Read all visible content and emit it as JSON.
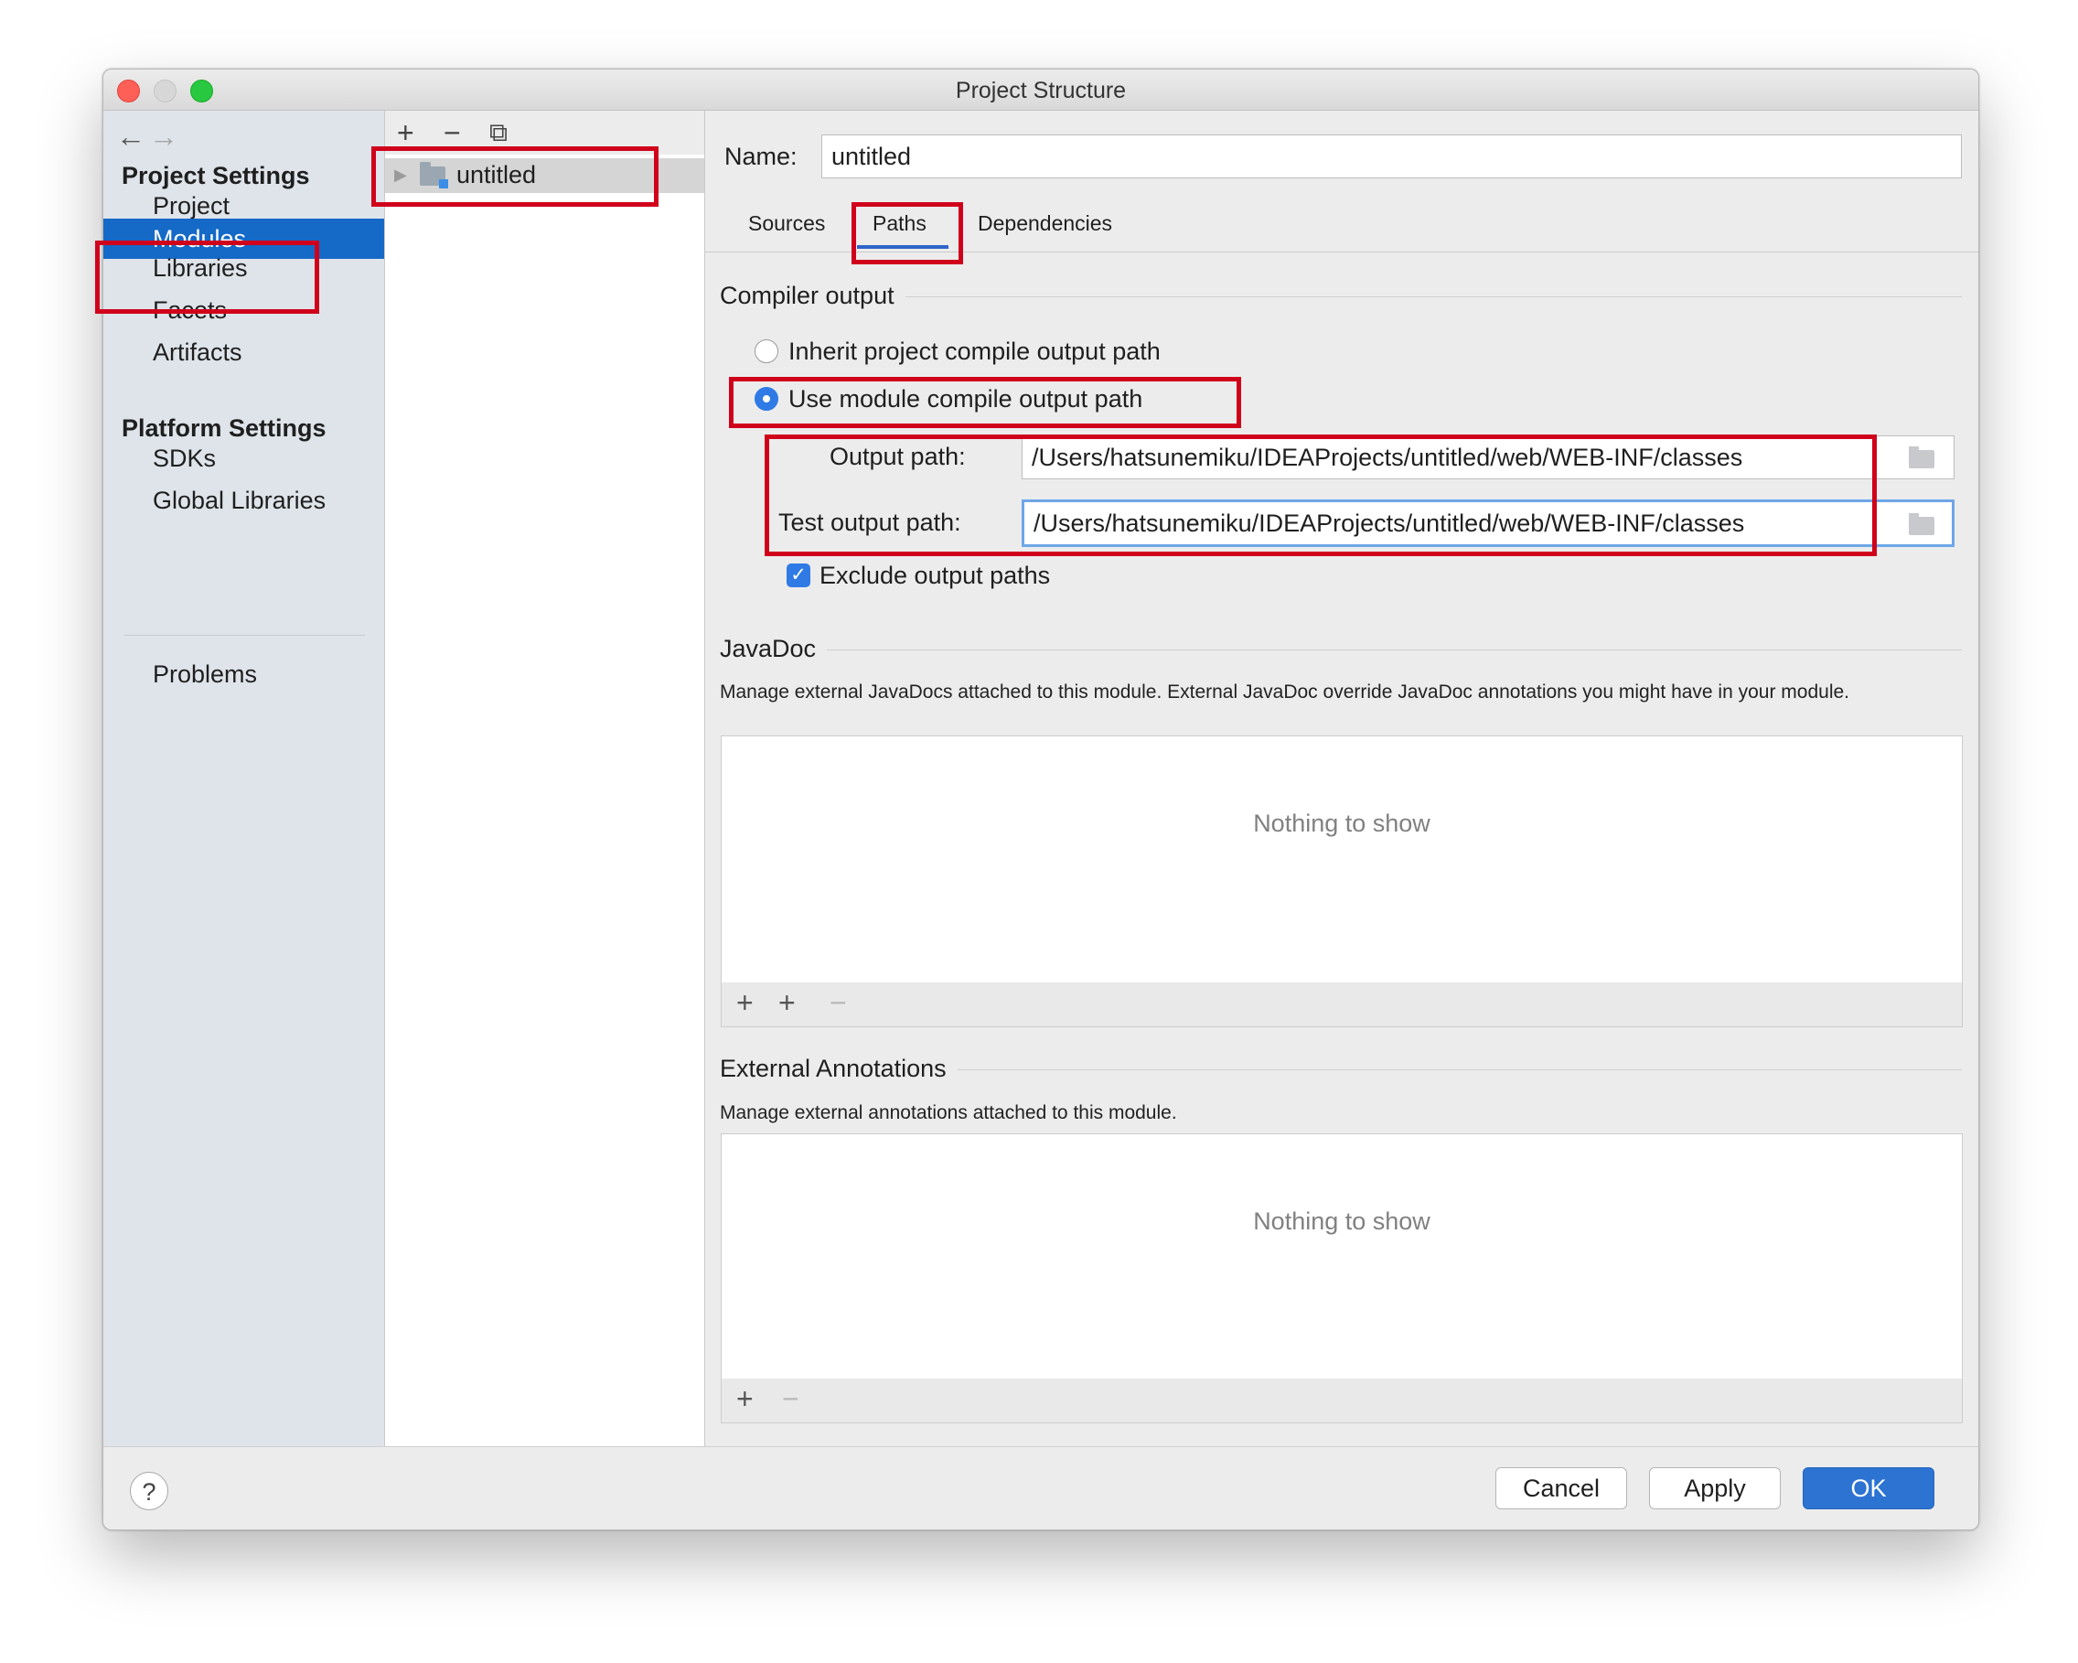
{
  "window": {
    "title": "Project Structure"
  },
  "sidebar": {
    "project_settings_heading": "Project Settings",
    "project_items": [
      "Project",
      "Modules",
      "Libraries",
      "Facets",
      "Artifacts"
    ],
    "platform_settings_heading": "Platform Settings",
    "platform_items": [
      "SDKs",
      "Global Libraries"
    ],
    "problems": "Problems",
    "selected": "Modules"
  },
  "modules_panel": {
    "toolbar": {
      "add": "+",
      "remove": "−",
      "copy": "⧉"
    },
    "items": [
      {
        "label": "untitled",
        "icon": "module-folder-icon"
      }
    ]
  },
  "module": {
    "name_label": "Name:",
    "name_value": "untitled",
    "tabs": [
      "Sources",
      "Paths",
      "Dependencies"
    ],
    "active_tab": "Paths"
  },
  "compiler_output": {
    "title": "Compiler output",
    "inherit_option": "Inherit project compile output path",
    "use_module_option": "Use module compile output path",
    "selected_option": "use_module",
    "output_path_label": "Output path:",
    "output_path_value": "/Users/hatsunemiku/IDEAProjects/untitled/web/WEB-INF/classes",
    "test_output_path_label": "Test output path:",
    "test_output_path_value": "/Users/hatsunemiku/IDEAProjects/untitled/web/WEB-INF/classes",
    "exclude_label": "Exclude output paths",
    "exclude_checked": true
  },
  "javadoc": {
    "title": "JavaDoc",
    "description": "Manage external JavaDocs attached to this module. External JavaDoc override JavaDoc annotations you might have in your module.",
    "empty_text": "Nothing to show",
    "toolbar": {
      "add": "+",
      "add_url": "+",
      "remove": "−"
    }
  },
  "external_annotations": {
    "title": "External Annotations",
    "description": "Manage external annotations attached to this module.",
    "empty_text": "Nothing to show",
    "toolbar": {
      "add": "+",
      "remove": "−"
    }
  },
  "footer": {
    "help": "?",
    "cancel": "Cancel",
    "apply": "Apply",
    "ok": "OK"
  },
  "nav": {
    "back": "←",
    "forward": "→"
  },
  "colors": {
    "selection": "#1569c7",
    "accent": "#2c73d2",
    "annotation_red": "#d0021b"
  }
}
